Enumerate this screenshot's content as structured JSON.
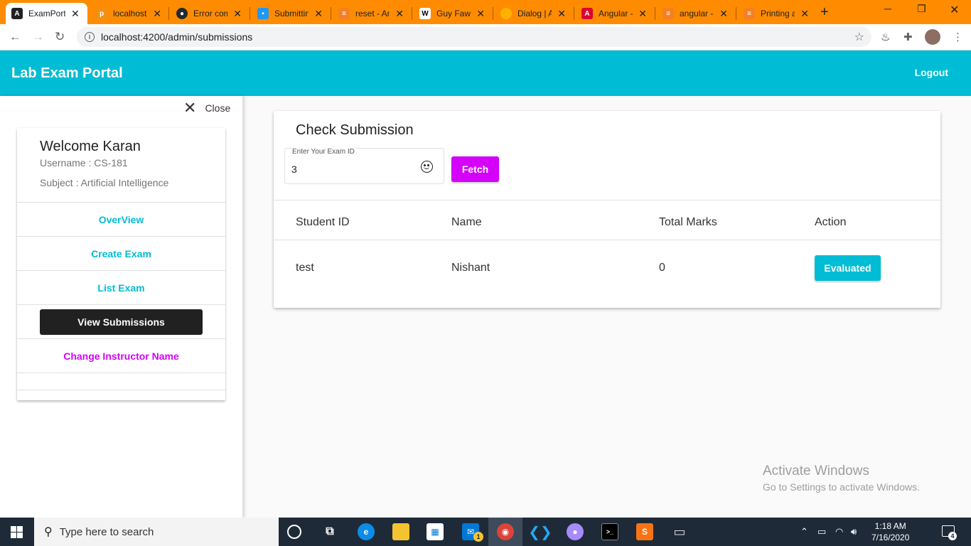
{
  "browser": {
    "tabs": [
      {
        "title": "ExamPortal",
        "favicon": "angular-icon",
        "color": "#dd0031",
        "active": true
      },
      {
        "title": "localhost",
        "favicon": "phpmyadmin-icon",
        "color": "#f29111",
        "active": false
      },
      {
        "title": "Error com",
        "favicon": "github-icon",
        "color": "#24292e",
        "active": false
      },
      {
        "title": "Submitting",
        "favicon": "chat-icon",
        "color": "#2196f3",
        "active": false
      },
      {
        "title": "reset - An",
        "favicon": "stackoverflow-icon",
        "color": "#f48024",
        "active": false
      },
      {
        "title": "Guy Fawk",
        "favicon": "wikipedia-icon",
        "color": "#ffffff",
        "active": false
      },
      {
        "title": "Dialog | A",
        "favicon": "material-icon",
        "color": "#ffb300",
        "active": false
      },
      {
        "title": "Angular -",
        "favicon": "angular-icon",
        "color": "#dd0031",
        "active": false
      },
      {
        "title": "angular -",
        "favicon": "stackoverflow-icon",
        "color": "#f48024",
        "active": false
      },
      {
        "title": "Printing a",
        "favicon": "stackoverflow-icon",
        "color": "#f48024",
        "active": false
      }
    ],
    "url": "localhost:4200/admin/submissions",
    "tabstrip_color": "#ff8c00"
  },
  "app": {
    "title": "Lab Exam Portal",
    "logout_label": "Logout",
    "primary_color": "#00bcd4",
    "accent_color": "#d500f9"
  },
  "sidebar": {
    "close_label": "Close",
    "welcome": "Welcome Karan",
    "username": "Username : CS-181",
    "subject": "Subject : Artificial Intelligence",
    "nav": [
      {
        "label": "OverView"
      },
      {
        "label": "Create Exam"
      },
      {
        "label": "List Exam"
      },
      {
        "label": "View Submissions",
        "active": true
      },
      {
        "label": "Change Instructor Name"
      }
    ]
  },
  "main": {
    "title": "Check Submission",
    "exam_id_label": "Enter Your Exam ID",
    "exam_id_value": "3",
    "fetch_label": "Fetch",
    "table": {
      "headers": [
        "Student ID",
        "Name",
        "Total Marks",
        "Action"
      ],
      "rows": [
        {
          "student_id": "test",
          "name": "Nishant",
          "total_marks": "0",
          "action": "Evaluated"
        }
      ]
    }
  },
  "watermark": {
    "line1": "Activate Windows",
    "line2": "Go to Settings to activate Windows."
  },
  "taskbar": {
    "search_placeholder": "Type here to search",
    "time": "1:18 AM",
    "date": "7/16/2020",
    "notification_count": "4",
    "mail_badge": "1"
  }
}
